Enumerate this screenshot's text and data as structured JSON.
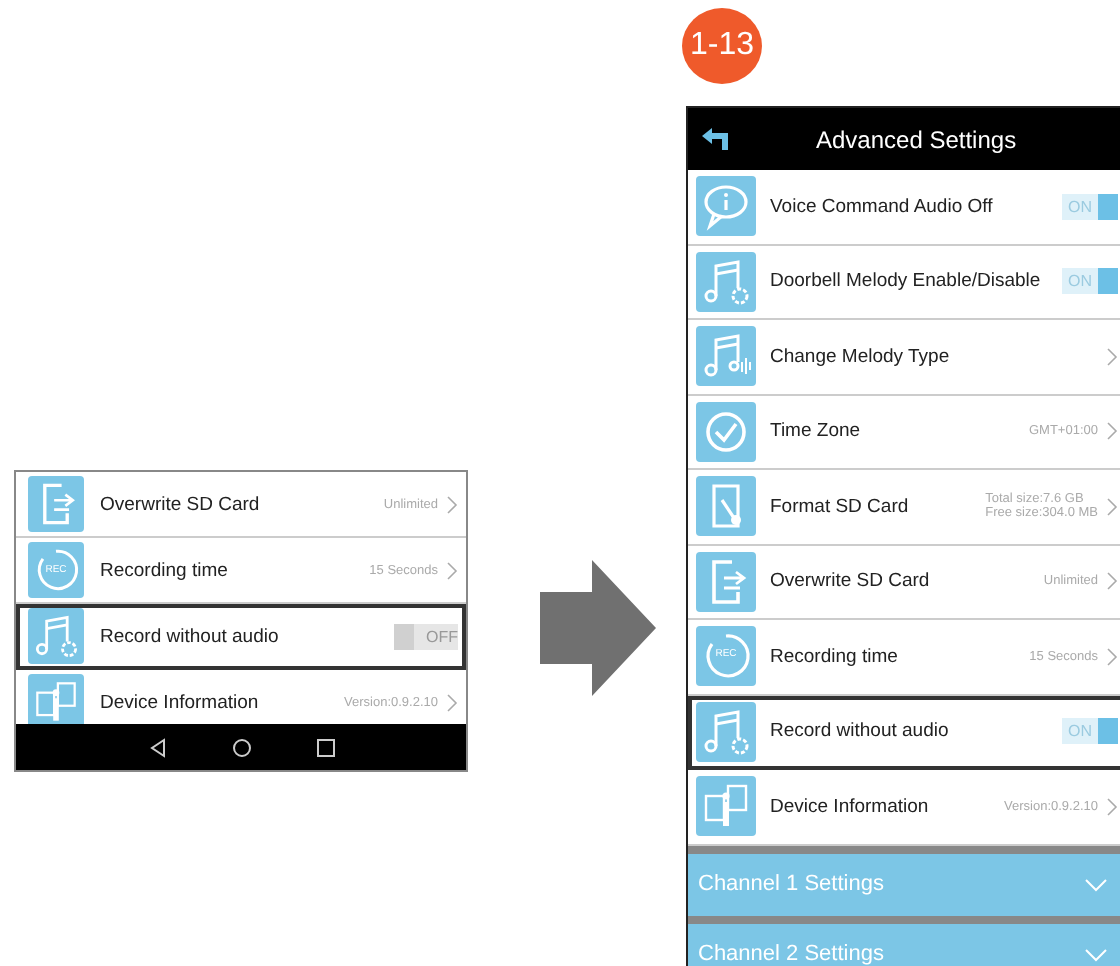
{
  "before_screen": {
    "rows": [
      {
        "label": "Overwrite SD Card",
        "kind": "link",
        "values": [
          "Unlimited"
        ],
        "highlighted": false
      },
      {
        "icon_text": "REC",
        "label": "Recording time",
        "kind": "link",
        "values": [
          "15 Seconds"
        ],
        "highlighted": false
      },
      {
        "label": "Record without audio",
        "kind": "toggle",
        "on": false,
        "state_label": "OFF",
        "highlighted": true
      },
      {
        "label": "Device Information",
        "kind": "link",
        "values": [
          "Version:0.9.2.10"
        ],
        "highlighted": false
      }
    ]
  },
  "step_badge": "1-13",
  "after_screen": {
    "title": "Advanced Settings",
    "rows": [
      {
        "label": "Voice Command Audio Off",
        "kind": "toggle",
        "on": true,
        "state_label": "ON",
        "highlighted": false
      },
      {
        "label": "Doorbell Melody Enable/Disable",
        "kind": "toggle",
        "on": true,
        "state_label": "ON",
        "highlighted": false
      },
      {
        "label": "Change Melody Type",
        "kind": "link",
        "highlighted": false
      },
      {
        "label": "Time Zone",
        "kind": "link",
        "values": [
          "GMT+01:00"
        ],
        "highlighted": false
      },
      {
        "label": "Format SD Card",
        "kind": "link",
        "values": [
          "Total size:7.6 GB",
          "Free size:304.0 MB"
        ],
        "highlighted": false
      },
      {
        "label": "Overwrite SD Card",
        "kind": "link",
        "values": [
          "Unlimited"
        ],
        "highlighted": false
      },
      {
        "icon_text": "REC",
        "label": "Recording time",
        "kind": "link",
        "values": [
          "15 Seconds"
        ],
        "highlighted": false
      },
      {
        "label": "Record without audio",
        "kind": "toggle",
        "on": true,
        "state_label": "ON",
        "highlighted": true
      },
      {
        "label": "Device Information",
        "kind": "link",
        "values": [
          "Version:0.9.2.10"
        ],
        "highlighted": false
      }
    ],
    "sections": [
      {
        "label": "Channel 1 Settings"
      },
      {
        "label": "Channel 2 Settings"
      }
    ]
  }
}
